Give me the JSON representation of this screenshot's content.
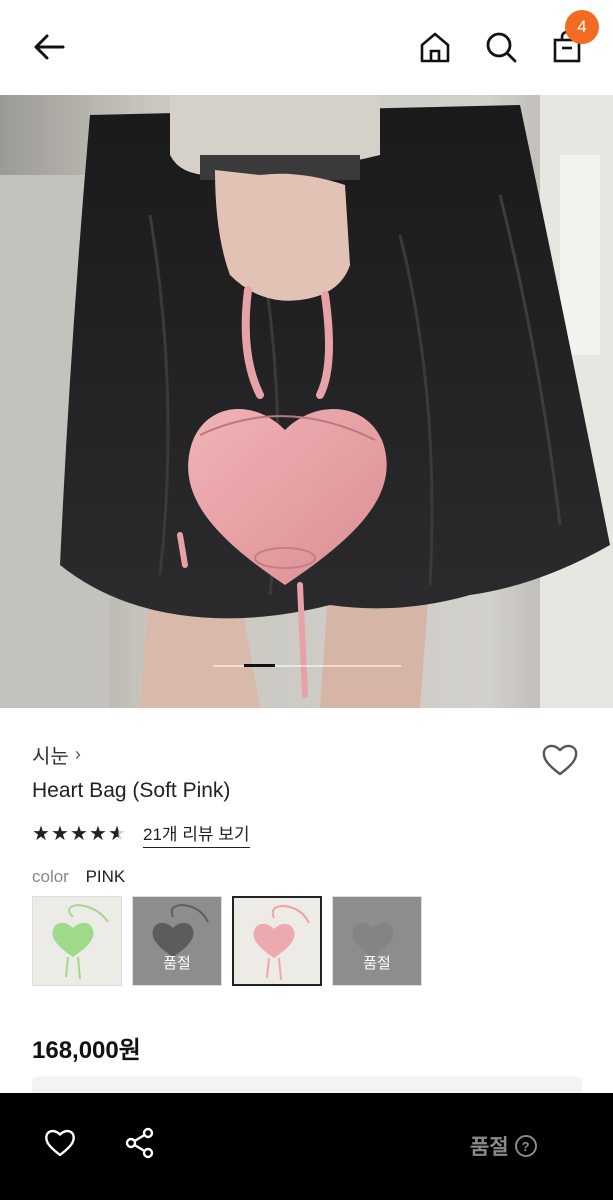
{
  "header": {
    "cart_count": "4"
  },
  "product": {
    "brand": "시눈",
    "brand_chevron": "›",
    "name": "Heart Bag (Soft Pink)",
    "rating": 4.5,
    "review_link": "21개 리뷰 보기",
    "color_label": "color",
    "color_value": "PINK",
    "price": "168,000원"
  },
  "swatches": [
    {
      "color": "green",
      "sold_out": false,
      "sold_label": ""
    },
    {
      "color": "black",
      "sold_out": true,
      "sold_label": "품절"
    },
    {
      "color": "pink",
      "sold_out": false,
      "selected": true,
      "sold_label": ""
    },
    {
      "color": "gray",
      "sold_out": true,
      "sold_label": "품절"
    }
  ],
  "bottom_bar": {
    "sold_out_label": "품절",
    "help_glyph": "?"
  },
  "gallery": {
    "current_slide": 2
  },
  "icons": [
    "back-arrow-icon",
    "home-icon",
    "search-icon",
    "shopping-bag-icon",
    "heart-icon",
    "share-icon",
    "question-icon",
    "star-icon"
  ],
  "colors": {
    "badge": "#f36b21",
    "bottom_bar": "#000000",
    "sold_text": "#8a8a8a"
  }
}
